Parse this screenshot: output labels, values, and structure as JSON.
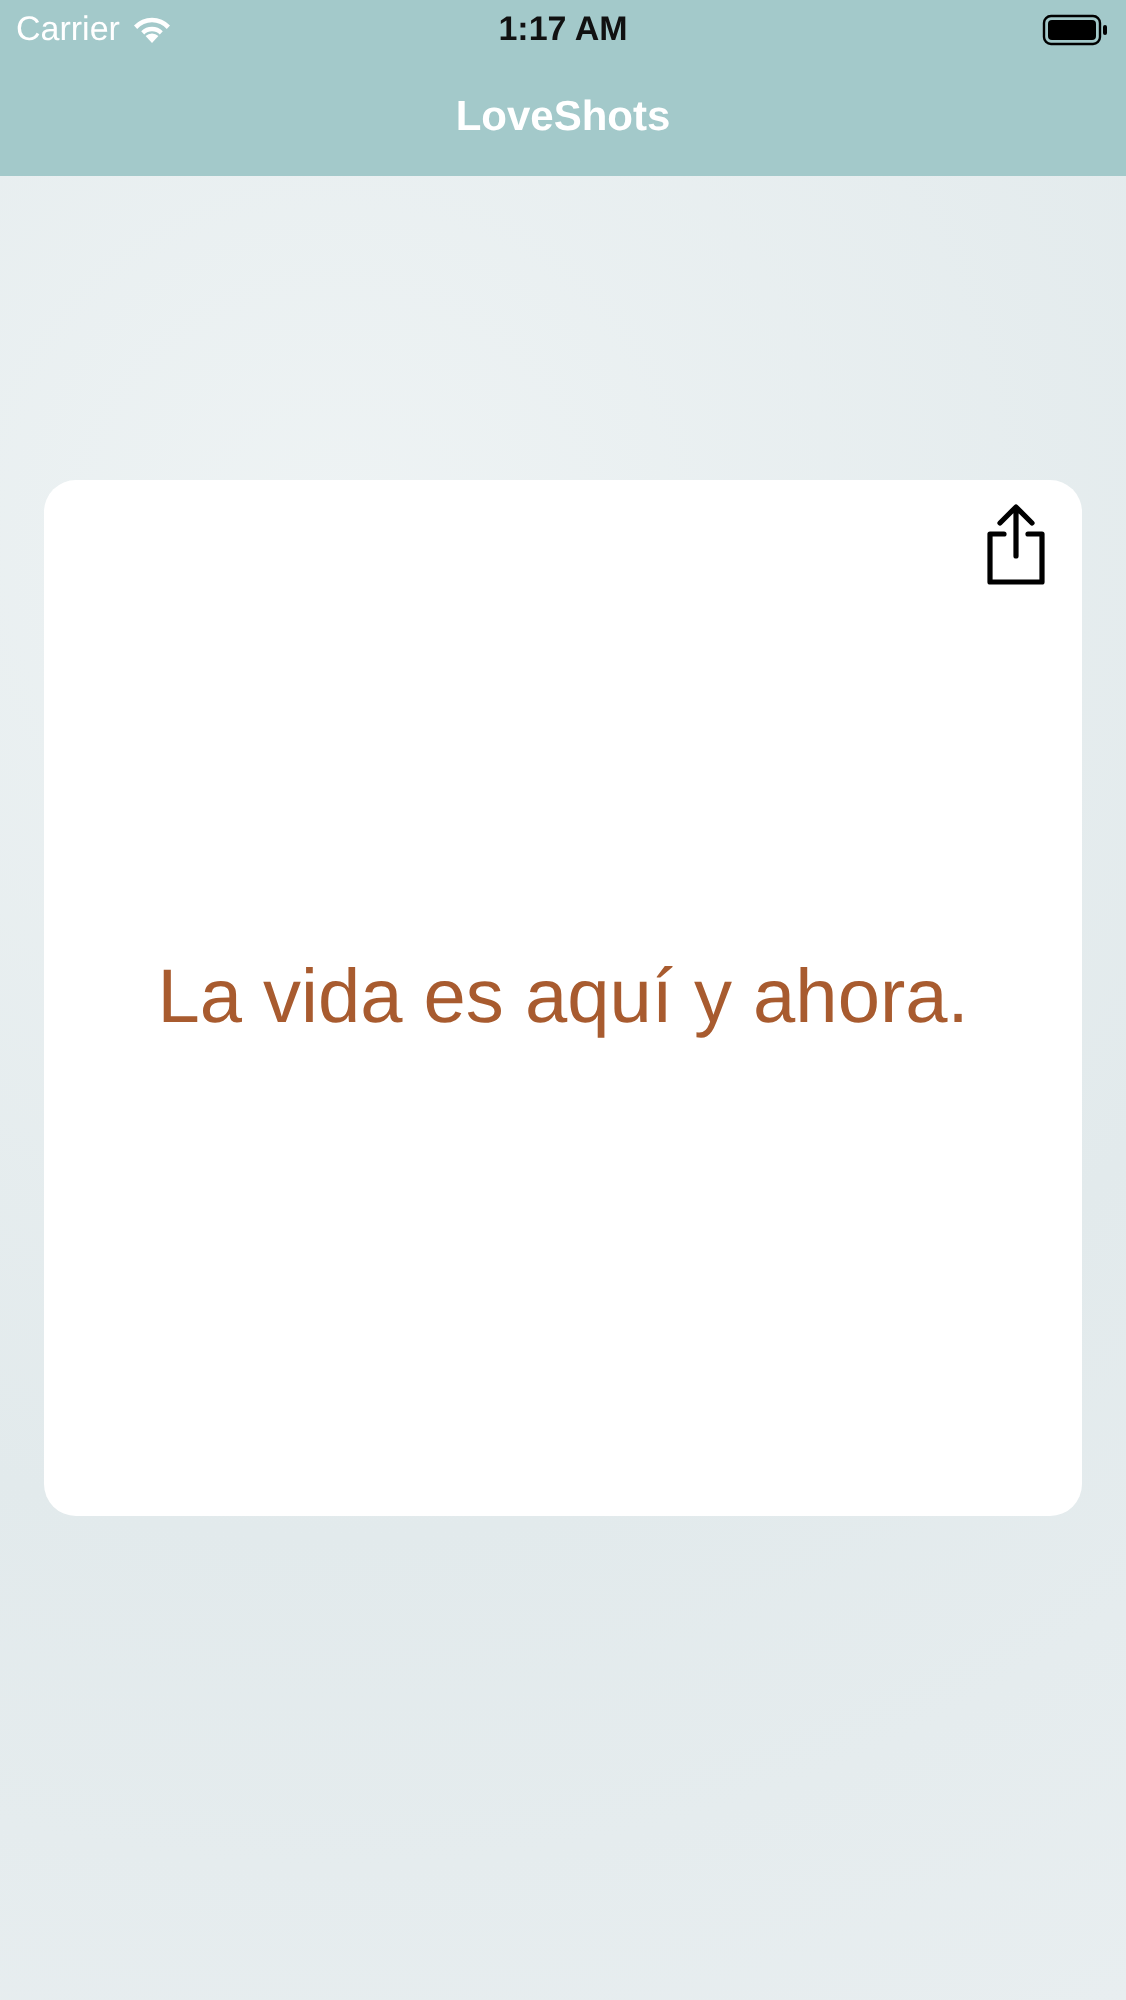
{
  "status_bar": {
    "carrier": "Carrier",
    "time": "1:17 AM"
  },
  "nav_bar": {
    "title": "LoveShots"
  },
  "card": {
    "quote": "La vida es aquí y ahora."
  }
}
